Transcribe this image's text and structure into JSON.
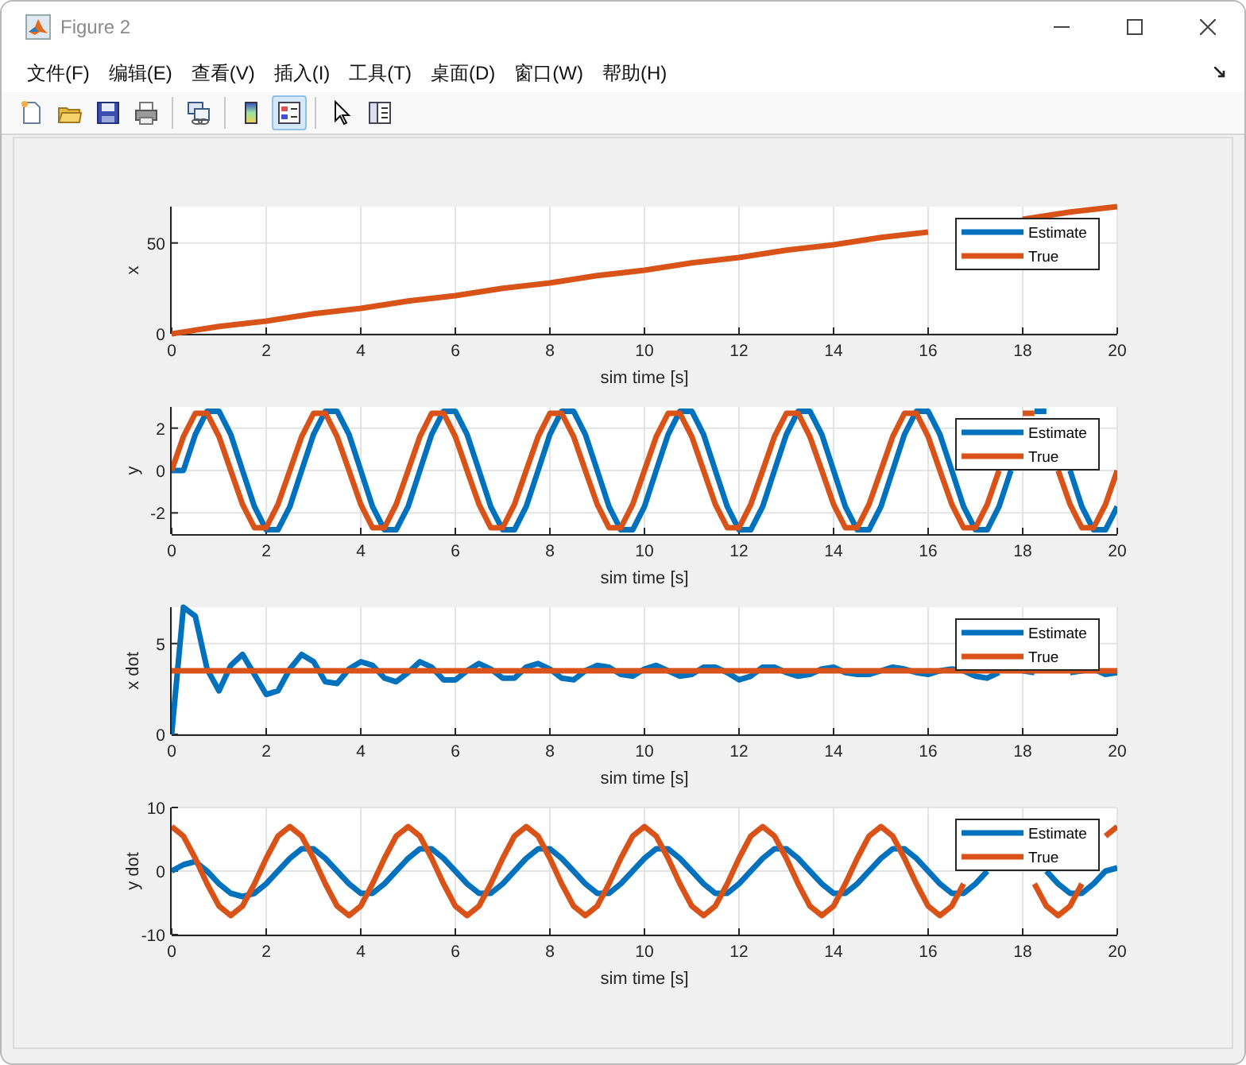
{
  "window": {
    "title": "Figure 2"
  },
  "menu": [
    "文件(F)",
    "编辑(E)",
    "查看(V)",
    "插入(I)",
    "工具(T)",
    "桌面(D)",
    "窗口(W)",
    "帮助(H)"
  ],
  "toolbar": [
    {
      "kind": "new",
      "pressed": false
    },
    {
      "kind": "open",
      "pressed": false
    },
    {
      "kind": "save",
      "pressed": false
    },
    {
      "kind": "print",
      "pressed": false
    },
    {
      "kind": "separator"
    },
    {
      "kind": "link",
      "pressed": false
    },
    {
      "kind": "separator"
    },
    {
      "kind": "colorbar",
      "pressed": false
    },
    {
      "kind": "legend",
      "pressed": true
    },
    {
      "kind": "separator"
    },
    {
      "kind": "pointer",
      "pressed": false
    },
    {
      "kind": "inspector",
      "pressed": false
    }
  ],
  "axes": [
    {
      "chart_data": {
        "type": "line",
        "xlabel": "sim time [s]",
        "ylabel": "x",
        "grid": true,
        "legend": true,
        "xlim": [
          0,
          20
        ],
        "ylim": [
          0,
          70
        ],
        "xticks": [
          0,
          2,
          4,
          6,
          8,
          10,
          12,
          14,
          16,
          18,
          20
        ],
        "yticks": [
          0,
          50
        ],
        "x": [
          0,
          1,
          2,
          3,
          4,
          5,
          6,
          7,
          8,
          9,
          10,
          11,
          12,
          13,
          14,
          15,
          16,
          17,
          18,
          19,
          20
        ],
        "series": [
          {
            "name": "Estimate",
            "color": "#0072bd",
            "values": [
              null,
              null,
              null,
              null,
              null,
              null,
              null,
              null,
              null,
              null,
              null,
              null,
              null,
              null,
              null,
              null,
              null,
              null,
              null,
              null,
              null
            ]
          },
          {
            "name": "True",
            "color": "#d95319",
            "values": [
              0,
              4,
              7,
              11,
              14,
              18,
              21,
              25,
              28,
              32,
              35,
              39,
              42,
              46,
              49,
              53,
              56,
              null,
              63,
              67,
              70
            ]
          }
        ]
      }
    },
    {
      "chart_data": {
        "type": "line",
        "xlabel": "sim time [s]",
        "ylabel": "y",
        "grid": true,
        "legend": true,
        "xlim": [
          0,
          20
        ],
        "ylim": [
          -3,
          3
        ],
        "xticks": [
          0,
          2,
          4,
          6,
          8,
          10,
          12,
          14,
          16,
          18,
          20
        ],
        "yticks": [
          -2,
          0,
          2
        ],
        "x": [
          0,
          0.25,
          0.5,
          0.75,
          1,
          1.25,
          1.5,
          1.75,
          2,
          2.25,
          2.5,
          2.75,
          3,
          3.25,
          3.5,
          3.75,
          4,
          4.25,
          4.5,
          4.75,
          5,
          5.25,
          5.5,
          5.75,
          6,
          6.25,
          6.5,
          6.75,
          7,
          7.25,
          7.5,
          7.75,
          8,
          8.25,
          8.5,
          8.75,
          9,
          9.25,
          9.5,
          9.75,
          10,
          10.25,
          10.5,
          10.75,
          11,
          11.25,
          11.5,
          11.75,
          12,
          12.25,
          12.5,
          12.75,
          13,
          13.25,
          13.5,
          13.75,
          14,
          14.25,
          14.5,
          14.75,
          15,
          15.25,
          15.5,
          15.75,
          16,
          16.25,
          16.5,
          16.75,
          17,
          17.25,
          17.5,
          17.75,
          18,
          18.25,
          18.5,
          18.75,
          19,
          19.25,
          19.5,
          19.75,
          20
        ],
        "series": [
          {
            "name": "Estimate",
            "color": "#0072bd",
            "values": [
              0,
              0,
              1.7,
              2.8,
              2.8,
              1.7,
              0,
              -1.7,
              -2.8,
              -2.8,
              -1.7,
              0,
              1.7,
              2.8,
              2.8,
              1.7,
              0,
              -1.7,
              -2.8,
              -2.8,
              -1.7,
              0,
              1.7,
              2.8,
              2.8,
              1.7,
              0,
              -1.7,
              -2.8,
              -2.8,
              -1.7,
              0,
              1.7,
              2.8,
              2.8,
              1.7,
              0,
              -1.7,
              -2.8,
              -2.8,
              -1.7,
              0,
              1.7,
              2.8,
              2.8,
              1.7,
              0,
              -1.7,
              -2.8,
              -2.8,
              -1.7,
              0,
              1.7,
              2.8,
              2.8,
              1.7,
              0,
              -1.7,
              -2.8,
              -2.8,
              -1.7,
              0,
              1.7,
              2.8,
              2.8,
              1.7,
              0,
              -1.7,
              -2.8,
              -2.8,
              -1.7,
              0,
              null,
              2.8,
              2.8,
              null,
              0,
              -1.7,
              -2.8,
              -2.8,
              -1.7
            ]
          },
          {
            "name": "True",
            "color": "#d95319",
            "values": [
              0,
              1.6,
              2.7,
              2.7,
              1.6,
              0,
              -1.6,
              -2.7,
              -2.7,
              -1.6,
              0,
              1.6,
              2.7,
              2.7,
              1.6,
              0,
              -1.6,
              -2.7,
              -2.7,
              -1.6,
              0,
              1.6,
              2.7,
              2.7,
              1.6,
              0,
              -1.6,
              -2.7,
              -2.7,
              -1.6,
              0,
              1.6,
              2.7,
              2.7,
              1.6,
              0,
              -1.6,
              -2.7,
              -2.7,
              -1.6,
              0,
              1.6,
              2.7,
              2.7,
              1.6,
              0,
              -1.6,
              -2.7,
              -2.7,
              -1.6,
              0,
              1.6,
              2.7,
              2.7,
              1.6,
              0,
              -1.6,
              -2.7,
              -2.7,
              -1.6,
              0,
              1.6,
              2.7,
              2.7,
              1.6,
              0,
              -1.6,
              -2.7,
              -2.7,
              -1.6,
              0,
              null,
              2.7,
              2.7,
              null,
              0,
              -1.6,
              -2.7,
              -2.7,
              -1.6,
              0
            ]
          }
        ]
      }
    },
    {
      "chart_data": {
        "type": "line",
        "xlabel": "sim time [s]",
        "ylabel": "x dot",
        "grid": true,
        "legend": true,
        "xlim": [
          0,
          20
        ],
        "ylim": [
          0,
          7
        ],
        "xticks": [
          0,
          2,
          4,
          6,
          8,
          10,
          12,
          14,
          16,
          18,
          20
        ],
        "yticks": [
          0,
          5
        ],
        "x": [
          0,
          0.25,
          0.5,
          0.75,
          1,
          1.25,
          1.5,
          1.75,
          2,
          2.25,
          2.5,
          2.75,
          3,
          3.25,
          3.5,
          3.75,
          4,
          4.25,
          4.5,
          4.75,
          5,
          5.25,
          5.5,
          5.75,
          6,
          6.25,
          6.5,
          6.75,
          7,
          7.25,
          7.5,
          7.75,
          8,
          8.25,
          8.5,
          8.75,
          9,
          9.25,
          9.5,
          9.75,
          10,
          10.25,
          10.5,
          10.75,
          11,
          11.25,
          11.5,
          11.75,
          12,
          12.25,
          12.5,
          12.75,
          13,
          13.25,
          13.5,
          13.75,
          14,
          14.25,
          14.5,
          14.75,
          15,
          15.25,
          15.5,
          15.75,
          16,
          16.25,
          16.5,
          16.75,
          17,
          17.25,
          17.5,
          17.75,
          18,
          18.25,
          18.5,
          18.75,
          19,
          19.25,
          19.5,
          19.75,
          20
        ],
        "series": [
          {
            "name": "Estimate",
            "color": "#0072bd",
            "values": [
              0,
              7.0,
              6.5,
              3.6,
              2.4,
              3.8,
              4.4,
              3.3,
              2.2,
              2.4,
              3.6,
              4.4,
              4.0,
              2.9,
              2.8,
              3.6,
              4.0,
              3.8,
              3.1,
              2.9,
              3.4,
              4.0,
              3.7,
              3.0,
              3.0,
              3.5,
              3.9,
              3.6,
              3.1,
              3.1,
              3.7,
              3.9,
              3.6,
              3.1,
              3.0,
              3.5,
              3.8,
              3.7,
              3.3,
              3.2,
              3.6,
              3.8,
              3.5,
              3.2,
              3.3,
              3.7,
              3.7,
              3.4,
              3.0,
              3.2,
              3.7,
              3.7,
              3.4,
              3.2,
              3.3,
              3.6,
              3.7,
              3.4,
              3.3,
              3.3,
              3.5,
              3.7,
              3.6,
              3.4,
              3.3,
              3.5,
              3.6,
              3.5,
              3.2,
              3.1,
              3.4,
              null,
              3.5,
              3.4,
              null,
              null,
              3.4,
              3.5,
              3.6,
              3.3,
              3.4
            ]
          },
          {
            "name": "True",
            "color": "#d95319",
            "values": [
              3.5,
              3.5,
              3.5,
              3.5,
              3.5,
              3.5,
              3.5,
              3.5,
              3.5,
              3.5,
              3.5,
              3.5,
              3.5,
              3.5,
              3.5,
              3.5,
              3.5,
              3.5,
              3.5,
              3.5,
              3.5,
              3.5,
              3.5,
              3.5,
              3.5,
              3.5,
              3.5,
              3.5,
              3.5,
              3.5,
              3.5,
              3.5,
              3.5,
              3.5,
              3.5,
              3.5,
              3.5,
              3.5,
              3.5,
              3.5,
              3.5,
              3.5,
              3.5,
              3.5,
              3.5,
              3.5,
              3.5,
              3.5,
              3.5,
              3.5,
              3.5,
              3.5,
              3.5,
              3.5,
              3.5,
              3.5,
              3.5,
              3.5,
              3.5,
              3.5,
              3.5,
              3.5,
              3.5,
              3.5,
              3.5,
              3.5,
              3.5,
              3.5,
              3.5,
              3.5,
              3.5,
              3.5,
              3.5,
              3.5,
              3.5,
              3.5,
              3.5,
              3.5,
              3.5,
              3.5,
              3.5
            ]
          }
        ]
      }
    },
    {
      "chart_data": {
        "type": "line",
        "xlabel": "sim time [s]",
        "ylabel": "y dot",
        "grid": true,
        "legend": true,
        "xlim": [
          0,
          20
        ],
        "ylim": [
          -10,
          10
        ],
        "xticks": [
          0,
          2,
          4,
          6,
          8,
          10,
          12,
          14,
          16,
          18,
          20
        ],
        "yticks": [
          -10,
          0,
          10
        ],
        "x": [
          0,
          0.25,
          0.5,
          0.75,
          1,
          1.25,
          1.5,
          1.75,
          2,
          2.25,
          2.5,
          2.75,
          3,
          3.25,
          3.5,
          3.75,
          4,
          4.25,
          4.5,
          4.75,
          5,
          5.25,
          5.5,
          5.75,
          6,
          6.25,
          6.5,
          6.75,
          7,
          7.25,
          7.5,
          7.75,
          8,
          8.25,
          8.5,
          8.75,
          9,
          9.25,
          9.5,
          9.75,
          10,
          10.25,
          10.5,
          10.75,
          11,
          11.25,
          11.5,
          11.75,
          12,
          12.25,
          12.5,
          12.75,
          13,
          13.25,
          13.5,
          13.75,
          14,
          14.25,
          14.5,
          14.75,
          15,
          15.25,
          15.5,
          15.75,
          16,
          16.25,
          16.5,
          16.75,
          17,
          17.25,
          17.5,
          17.75,
          18,
          18.25,
          18.5,
          18.75,
          19,
          19.25,
          19.5,
          19.75,
          20
        ],
        "series": [
          {
            "name": "Estimate",
            "color": "#0072bd",
            "values": [
              0,
              1,
              1.5,
              0,
              -2,
              -3.5,
              -4,
              -3.5,
              -2,
              0,
              2,
              3.5,
              3.5,
              2,
              0,
              -2,
              -3.5,
              -3.5,
              -2,
              0,
              2,
              3.5,
              3.5,
              2,
              0,
              -2,
              -3.5,
              -3.5,
              -2,
              0,
              2,
              3.5,
              3.5,
              2,
              0,
              -2,
              -3.5,
              -3.5,
              -2,
              0,
              2,
              3.5,
              3.5,
              2,
              0,
              -2,
              -3.5,
              -3.5,
              -2,
              0,
              2,
              3.5,
              3.5,
              2,
              0,
              -2,
              -3.5,
              -3.5,
              -2,
              0,
              2,
              3.5,
              3.5,
              2,
              0,
              -2,
              -3.5,
              -3.5,
              -2,
              0,
              null,
              null,
              null,
              null,
              0,
              -2,
              -3.5,
              -3.5,
              -2,
              0,
              0.5
            ]
          },
          {
            "name": "True",
            "color": "#d95319",
            "values": [
              7,
              5.5,
              2,
              -2,
              -5.5,
              -7,
              -5.5,
              -2,
              2,
              5.5,
              7,
              5.5,
              2,
              -2,
              -5.5,
              -7,
              -5.5,
              -2,
              2,
              5.5,
              7,
              5.5,
              2,
              -2,
              -5.5,
              -7,
              -5.5,
              -2,
              2,
              5.5,
              7,
              5.5,
              2,
              -2,
              -5.5,
              -7,
              -5.5,
              -2,
              2,
              5.5,
              7,
              5.5,
              2,
              -2,
              -5.5,
              -7,
              -5.5,
              -2,
              2,
              5.5,
              7,
              5.5,
              2,
              -2,
              -5.5,
              -7,
              -5.5,
              -2,
              2,
              5.5,
              7,
              5.5,
              2,
              -2,
              -5.5,
              -7,
              -5.5,
              -2,
              null,
              null,
              null,
              null,
              null,
              -2,
              -5.5,
              -7,
              -5.5,
              -2,
              null,
              5.5,
              7
            ]
          }
        ]
      }
    }
  ]
}
